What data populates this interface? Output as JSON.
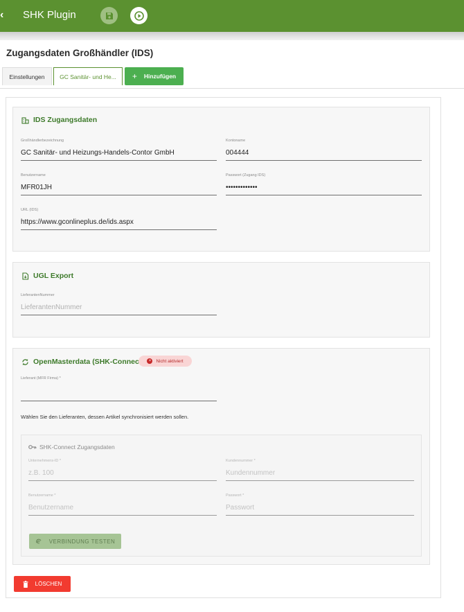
{
  "app": {
    "title": "SHK Plugin",
    "back_glyph": "‹",
    "accent_color": "#5b9130",
    "header_icons": [
      "save-icon",
      "play-circle-icon"
    ]
  },
  "page": {
    "title": "Zugangsdaten Großhändler (IDS)"
  },
  "tabs": {
    "settings": "Einstellungen",
    "active": "GC Sanitär- und He...",
    "add": "Hinzufügen"
  },
  "ids_section": {
    "title": "IDS Zugangsdaten",
    "icon": "building-icon",
    "fields": {
      "wholesaler_name": {
        "label": "Großhändlerbezeichnung",
        "value": "GC Sanitär- und Heizungs-Handels-Contor GmbH"
      },
      "account_name": {
        "label": "Kontoname",
        "value": "004444"
      },
      "username": {
        "label": "Benutzername",
        "value": "MFR01JH"
      },
      "password": {
        "label": "Passwort (Zugang IDS)",
        "value": "•••••••••••••"
      },
      "url": {
        "label": "URL (IDS)",
        "value": "https://www.gconlineplus.de/ids.aspx"
      }
    }
  },
  "ugl_section": {
    "title": "UGL Export",
    "icon": "file-export-icon",
    "fields": {
      "supplier_number": {
        "label": "LieferantenNummer",
        "placeholder": "LieferantenNummer"
      }
    }
  },
  "omd_section": {
    "title": "OpenMasterdata (SHK-Connect)",
    "icon": "sync-icon",
    "status_badge": "Nicht aktiviert",
    "status_color": "#c62828",
    "fields": {
      "supplier": {
        "label": "Lieferant (MFR Firma) *",
        "value": ""
      }
    },
    "helper_text": "Wählen Sie den Lieferanten, dessen Artikel synchronisiert werden sollen.",
    "shk_connect": {
      "title": "SHK-Connect Zugangsdaten",
      "icon": "key-icon",
      "fields": {
        "company_id": {
          "label": "Unternehmens-ID *",
          "placeholder": "z.B. 100"
        },
        "customer_number": {
          "label": "Kundennummer *",
          "placeholder": "Kundennummer"
        },
        "username": {
          "label": "Benutzername *",
          "placeholder": "Benutzername"
        },
        "password": {
          "label": "Passwort *",
          "placeholder": "Passwort"
        }
      },
      "test_button": "VERBINDUNG TESTEN"
    }
  },
  "delete_button": "LÖSCHEN",
  "delete_color": "#f23b30"
}
